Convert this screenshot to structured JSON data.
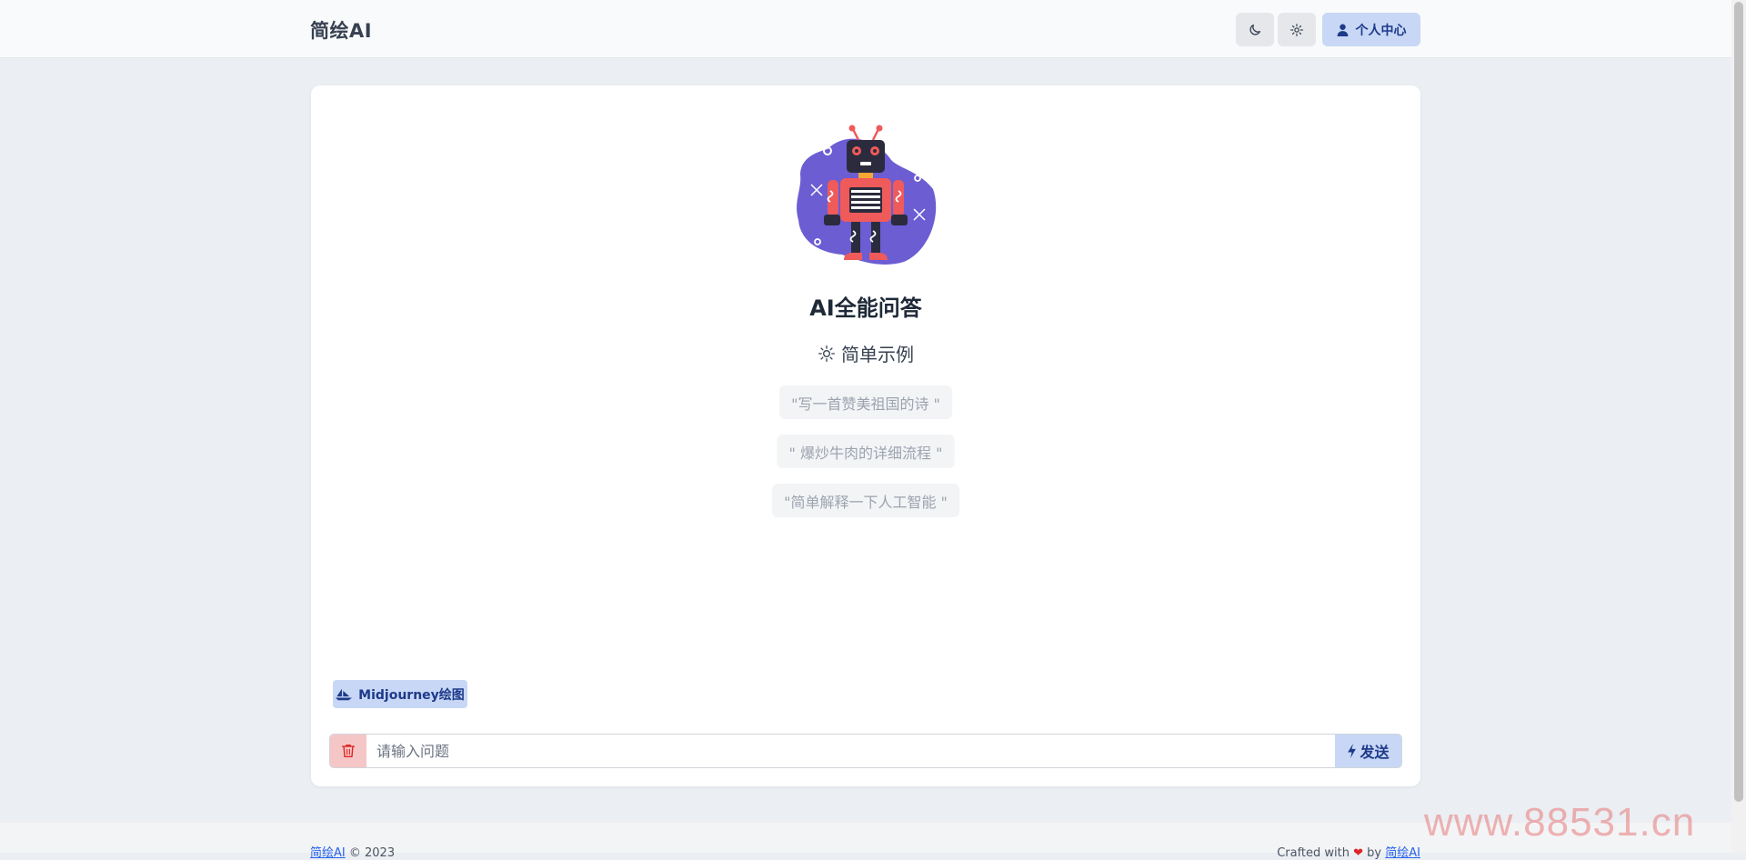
{
  "header": {
    "brand": "简绘AI",
    "profile_label": "个人中心"
  },
  "icons": {
    "theme": "moon-icon",
    "settings": "gear-icon",
    "profile": "user-icon",
    "examples": "sun-icon",
    "midjourney": "sailboat-icon",
    "clear": "trash-icon",
    "send": "bolt-icon"
  },
  "main": {
    "title": "AI全能问答",
    "examples_heading": "简单示例",
    "examples": [
      "\"写一首赞美祖国的诗 \"",
      "\" 爆炒牛肉的详细流程 \"",
      "\"简单解释一下人工智能 \""
    ],
    "midjourney_label": "Midjourney绘图",
    "input_placeholder": "请输入问题",
    "send_label": "发送"
  },
  "footer": {
    "left_link": "简绘AI",
    "left_text": "© 2023",
    "right_text": "Crafted with",
    "heart": "❤",
    "right_by": "by",
    "right_link": "简绘AI"
  },
  "watermark": "www.88531.cn",
  "colors": {
    "accent": "#c7d7f5",
    "accent_text": "#1e3a8a",
    "danger_bg": "#f5c6c6",
    "robot_blob": "#6c5dd3",
    "robot_body": "#ef5a5a"
  }
}
